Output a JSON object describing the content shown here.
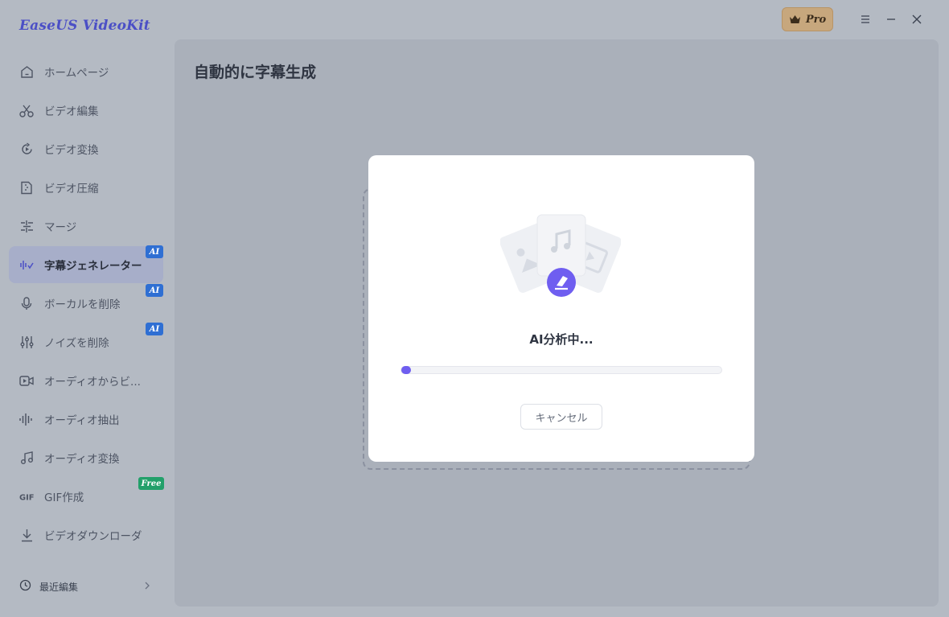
{
  "app": {
    "title": "EaseUS VideoKit",
    "pro_label": "Pro"
  },
  "window": {
    "menu_icon": "hamburger-icon",
    "minimize_icon": "minimize-icon",
    "close_icon": "close-icon"
  },
  "sidebar": {
    "items": [
      {
        "label": "ホームページ",
        "icon": "home-icon"
      },
      {
        "label": "ビデオ編集",
        "icon": "scissors-icon"
      },
      {
        "label": "ビデオ変換",
        "icon": "convert-icon"
      },
      {
        "label": "ビデオ圧縮",
        "icon": "compress-icon"
      },
      {
        "label": "マージ",
        "icon": "merge-icon"
      },
      {
        "label": "字幕ジェネレーター",
        "icon": "subtitle-icon",
        "badge": "AI",
        "active": true
      },
      {
        "label": "ボーカルを削除",
        "icon": "microphone-icon",
        "badge": "AI"
      },
      {
        "label": "ノイズを削除",
        "icon": "sliders-icon",
        "badge": "AI"
      },
      {
        "label": "オーディオからビ...",
        "icon": "video-camera-icon"
      },
      {
        "label": "オーディオ抽出",
        "icon": "waveform-icon"
      },
      {
        "label": "オーディオ変換",
        "icon": "music-note-icon"
      },
      {
        "label": "GIF作成",
        "icon": "gif-icon",
        "badge": "Free"
      },
      {
        "label": "ビデオダウンローダ",
        "icon": "download-icon"
      }
    ],
    "recent_label": "最近編集"
  },
  "main": {
    "title": "自動的に字幕生成"
  },
  "modal": {
    "status": "AI分析中...",
    "progress_percent": 3,
    "cancel_label": "キャンセル",
    "accent_color": "#6f5ef0"
  }
}
